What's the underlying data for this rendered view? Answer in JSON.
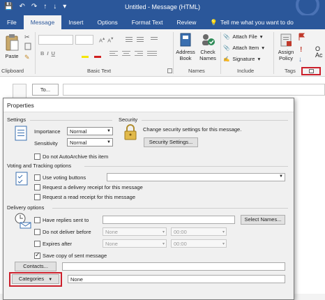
{
  "titlebar": {
    "title": "Untitled - Message (HTML)",
    "qat": [
      "💾",
      "↶",
      "↷",
      "↑",
      "↓",
      "▾"
    ]
  },
  "tabs": [
    {
      "label": "File"
    },
    {
      "label": "Message"
    },
    {
      "label": "Insert"
    },
    {
      "label": "Options"
    },
    {
      "label": "Format Text"
    },
    {
      "label": "Review"
    },
    {
      "label": "Tell me what you want to do"
    }
  ],
  "ribbon": {
    "clipboard": {
      "paste": "Paste",
      "label": "Clipboard"
    },
    "basic_text": {
      "label": "Basic Text"
    },
    "names": {
      "address_book": "Address\nBook",
      "check_names": "Check\nNames",
      "label": "Names"
    },
    "include": {
      "attach_file": "Attach File",
      "attach_item": "Attach Item",
      "signature": "Signature",
      "label": "Include"
    },
    "tags": {
      "assign_policy": "Assign\nPolicy",
      "label": "Tags"
    },
    "extra": {
      "o_label": "O",
      "ac_label": "Ac"
    }
  },
  "compose": {
    "to_label": "To..."
  },
  "dialog": {
    "title": "Properties",
    "settings": {
      "section": "Settings",
      "importance_label": "Importance",
      "importance_value": "Normal",
      "sensitivity_label": "Sensitivity",
      "sensitivity_value": "Normal",
      "do_not_autoarchive": "Do not AutoArchive this item"
    },
    "security": {
      "section": "Security",
      "text": "Change security settings for this message.",
      "button": "Security Settings..."
    },
    "voting": {
      "section": "Voting and Tracking options",
      "use_voting": "Use voting buttons",
      "delivery_receipt": "Request a delivery receipt for this message",
      "read_receipt": "Request a read receipt for this message"
    },
    "delivery": {
      "section": "Delivery options",
      "have_replies": "Have replies sent to",
      "select_names": "Select Names...",
      "do_not_deliver": "Do not deliver before",
      "expires_after": "Expires after",
      "none_value": "None",
      "time_value": "00:00",
      "save_copy": "Save copy of sent message"
    },
    "contacts_button": "Contacts...",
    "categories_button": "Categories",
    "categories_value": "None"
  },
  "colors": {
    "accent": "#2b579a",
    "highlight": "#cc1f2b",
    "flag": "#c0392b"
  }
}
